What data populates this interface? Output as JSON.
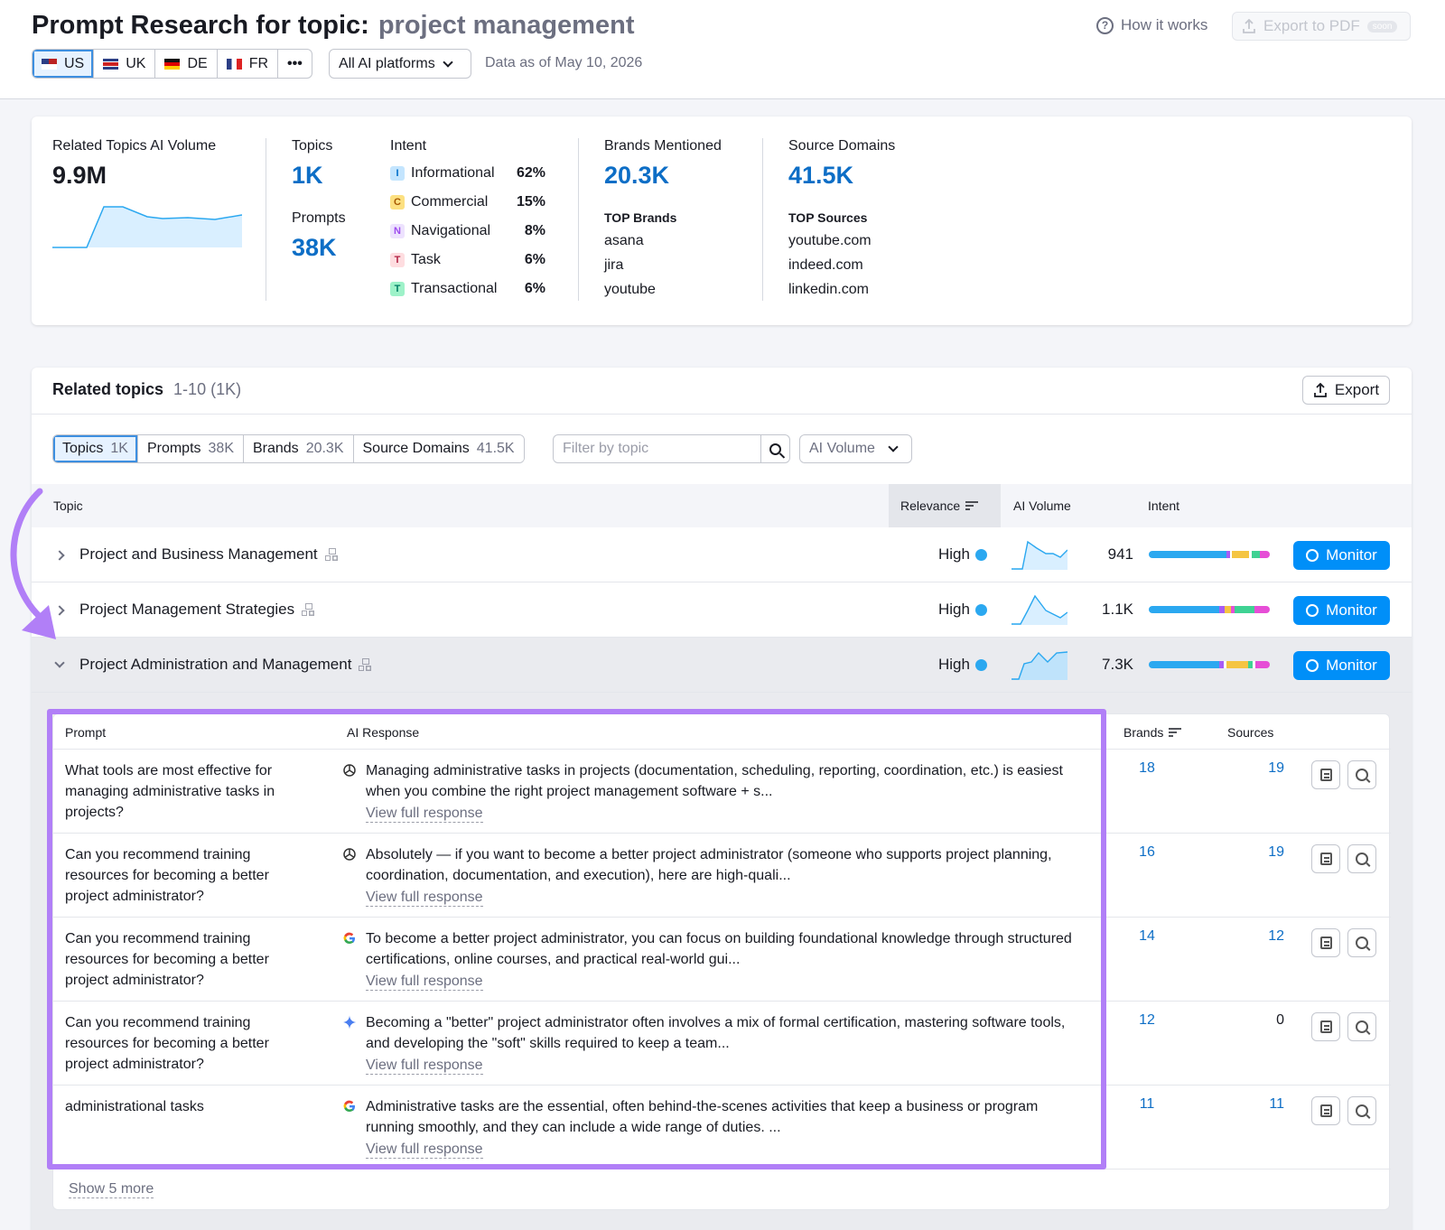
{
  "header": {
    "title": "Prompt Research for topic:",
    "topic": "project management",
    "how_it_works": "How it works",
    "export_pdf": "Export to PDF",
    "soon": "soon",
    "countries": [
      "US",
      "UK",
      "DE",
      "FR"
    ],
    "more": "•••",
    "platform": "All AI platforms",
    "data_as_of": "Data as of May 10, 2026"
  },
  "summary": {
    "related_volume_label": "Related Topics AI Volume",
    "related_volume": "9.9M",
    "topics_label": "Topics",
    "topics": "1K",
    "prompts_label": "Prompts",
    "prompts": "38K",
    "intent_label": "Intent",
    "intents": [
      {
        "badge": "I",
        "name": "Informational",
        "pct": "62%"
      },
      {
        "badge": "C",
        "name": "Commercial",
        "pct": "15%"
      },
      {
        "badge": "N",
        "name": "Navigational",
        "pct": "8%"
      },
      {
        "badge": "T",
        "name": "Task",
        "pct": "6%"
      },
      {
        "badge": "T",
        "name": "Transactional",
        "pct": "6%"
      }
    ],
    "brands_label": "Brands Mentioned",
    "brands": "20.3K",
    "top_brands_label": "TOP Brands",
    "top_brands": [
      "asana",
      "jira",
      "youtube"
    ],
    "sources_label": "Source Domains",
    "sources": "41.5K",
    "top_sources_label": "TOP Sources",
    "top_sources": [
      "youtube.com",
      "indeed.com",
      "linkedin.com"
    ]
  },
  "related": {
    "title": "Related topics",
    "range": "1-10 (1K)",
    "export": "Export",
    "tabs": [
      {
        "label": "Topics",
        "count": "1K"
      },
      {
        "label": "Prompts",
        "count": "38K"
      },
      {
        "label": "Brands",
        "count": "20.3K"
      },
      {
        "label": "Source Domains",
        "count": "41.5K"
      }
    ],
    "filter_placeholder": "Filter by topic",
    "sort_select": "AI Volume",
    "columns": {
      "topic": "Topic",
      "relevance": "Relevance",
      "volume": "AI Volume",
      "intent": "Intent"
    },
    "rows": [
      {
        "name": "Project and Business Management",
        "relevance": "High",
        "volume": "941",
        "monitor": "Monitor"
      },
      {
        "name": "Project Management Strategies",
        "relevance": "High",
        "volume": "1.1K",
        "monitor": "Monitor"
      },
      {
        "name": "Project Administration and Management",
        "relevance": "High",
        "volume": "7.3K",
        "monitor": "Monitor"
      }
    ]
  },
  "prompts": {
    "columns": {
      "prompt": "Prompt",
      "response": "AI Response",
      "brands": "Brands",
      "sources": "Sources"
    },
    "view_full": "View full response",
    "rows": [
      {
        "prompt": "What tools are most effective for managing administrative tasks in projects?",
        "engine": "chatgpt",
        "response": "Managing administrative tasks in projects (documentation, scheduling, reporting, coordination, etc.) is easiest when you combine the right project management software + s...",
        "brands": "18",
        "sources": "19"
      },
      {
        "prompt": "Can you recommend training resources for becoming a better project administrator?",
        "engine": "chatgpt",
        "response": "Absolutely — if you want to become a better project administrator (someone who supports project planning, coordination, documentation, and execution), here are high-quali...",
        "brands": "16",
        "sources": "19"
      },
      {
        "prompt": "Can you recommend training resources for becoming a better project administrator?",
        "engine": "google",
        "response": "To become a better project administrator, you can focus on building foundational knowledge through structured certifications, online courses, and practical real-world gui...",
        "brands": "14",
        "sources": "12"
      },
      {
        "prompt": "Can you recommend training resources for becoming a better project administrator?",
        "engine": "gemini",
        "response": "Becoming a \"better\" project administrator often involves a mix of formal certification, mastering software tools, and developing the \"soft\" skills required to keep a team...",
        "brands": "12",
        "sources": "0"
      },
      {
        "prompt": "administrational tasks",
        "engine": "google",
        "response": "Administrative tasks are the essential, often behind-the-scenes activities that keep a business or program running smoothly, and they can include a wide range of duties. ...",
        "brands": "11",
        "sources": "11"
      }
    ],
    "show_more": "Show 5 more"
  },
  "colors": {
    "accent": "#008ff8",
    "highlight": "#b17ff7",
    "blue_text": "#0d6ec6"
  }
}
